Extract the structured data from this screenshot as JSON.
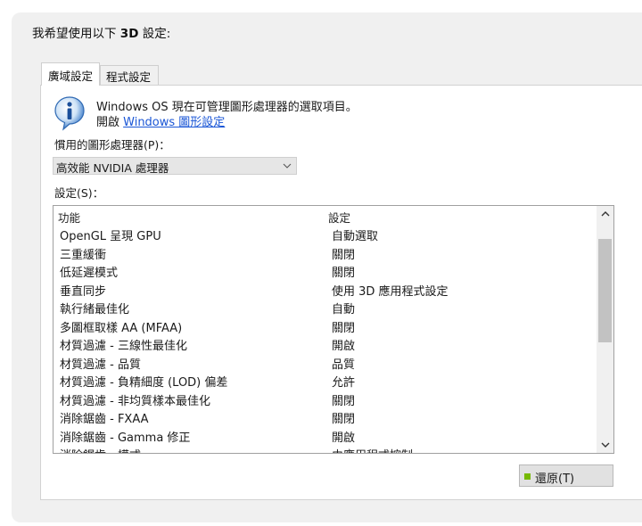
{
  "heading": {
    "prefix": "我希望使用以下 ",
    "bold": "3D",
    "suffix": " 設定:"
  },
  "tabs": [
    {
      "label": "廣域設定",
      "active": true
    },
    {
      "label": "程式設定",
      "active": false
    }
  ],
  "info": {
    "icon": "info-icon",
    "line1": "Windows OS 現在可管理圖形處理器的選取項目。",
    "line2_prefix": "開啟 ",
    "link": "Windows 圖形設定"
  },
  "preferred_gpu": {
    "label": "慣用的圖形處理器(P)：",
    "selected": "高效能 NVIDIA 處理器"
  },
  "settings": {
    "label": "設定(S)：",
    "columns": [
      "功能",
      "設定"
    ],
    "rows": [
      [
        "OpenGL 呈現 GPU",
        "自動選取"
      ],
      [
        "三重緩衝",
        "關閉"
      ],
      [
        "低延遲模式",
        "關閉"
      ],
      [
        "垂直同步",
        "使用 3D 應用程式設定"
      ],
      [
        "執行緒最佳化",
        "自動"
      ],
      [
        "多圖框取樣 AA (MFAA)",
        "關閉"
      ],
      [
        "材質過濾 - 三線性最佳化",
        "開啟"
      ],
      [
        "材質過濾 - 品質",
        "品質"
      ],
      [
        "材質過濾 - 負精細度 (LOD) 偏差",
        "允許"
      ],
      [
        "材質過濾 - 非均質樣本最佳化",
        "關閉"
      ],
      [
        "消除鋸齒 - FXAA",
        "關閉"
      ],
      [
        "消除鋸齒 - Gamma 修正",
        "開啟"
      ],
      [
        "消除鋸齒 - 模式",
        "由應用程式控制"
      ]
    ]
  },
  "restore_button": {
    "label": "還原(T)",
    "icon": "nvidia-icon",
    "accent": "#76b900"
  },
  "colors": {
    "link": "#1a56d6",
    "panel": "#f0f0f0"
  }
}
